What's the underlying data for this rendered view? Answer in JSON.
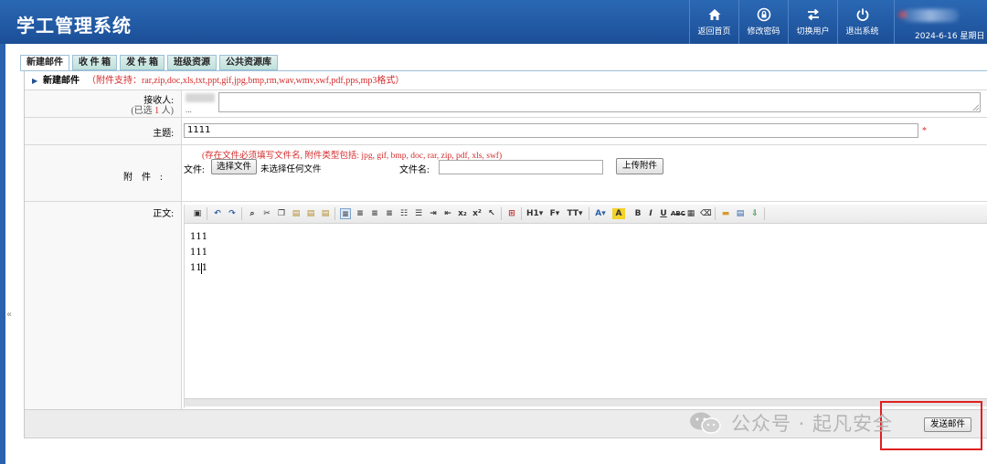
{
  "header": {
    "title": "学工管理系统",
    "nav": [
      {
        "label": "返回首页",
        "icon": "home-icon"
      },
      {
        "label": "修改密码",
        "icon": "lock-icon"
      },
      {
        "label": "切换用户",
        "icon": "switch-icon"
      },
      {
        "label": "退出系统",
        "icon": "power-icon"
      }
    ],
    "date": "2024-6-16 星期日"
  },
  "tabs": [
    {
      "label": "新建邮件",
      "active": true
    },
    {
      "label": "收 件 箱",
      "active": false
    },
    {
      "label": "发 件 箱",
      "active": false
    },
    {
      "label": "班级资源",
      "active": false
    },
    {
      "label": "公共资源库",
      "active": false
    }
  ],
  "form": {
    "section_title": "新建邮件",
    "attachment_support": "（附件支持：rar,zip,doc,xls,txt,ppt,gif,jpg,bmp,rm,wav,wmv,swf,pdf,pps,mp3格式）",
    "recipient_label": "接收人:",
    "recipient_selected_prefix": "(已选",
    "recipient_count": "1",
    "recipient_selected_suffix": "人)",
    "recipient_ellipsis": "...",
    "subject_label": "主题:",
    "subject_value": "1111",
    "required_mark": "*",
    "attachment_label": "附件:",
    "attachment_note": "(存在文件必须填写文件名, 附件类型包括: jpg, gif, bmp, doc, rar, zip, pdf, xls, swf)",
    "file_label": "文件:",
    "choose_file_button": "选择文件",
    "no_file_text": "未选择任何文件",
    "filename_label": "文件名:",
    "filename_value": "",
    "upload_button": "上传附件",
    "body_label": "正文:",
    "body_lines": [
      "111",
      "111",
      "111"
    ],
    "send_button": "发送邮件"
  },
  "colors": {
    "header_bg": "#1b4f97",
    "note_red": "#d42a2a",
    "highlight": "#e02020"
  },
  "watermark": "公众号 · 起凡安全"
}
